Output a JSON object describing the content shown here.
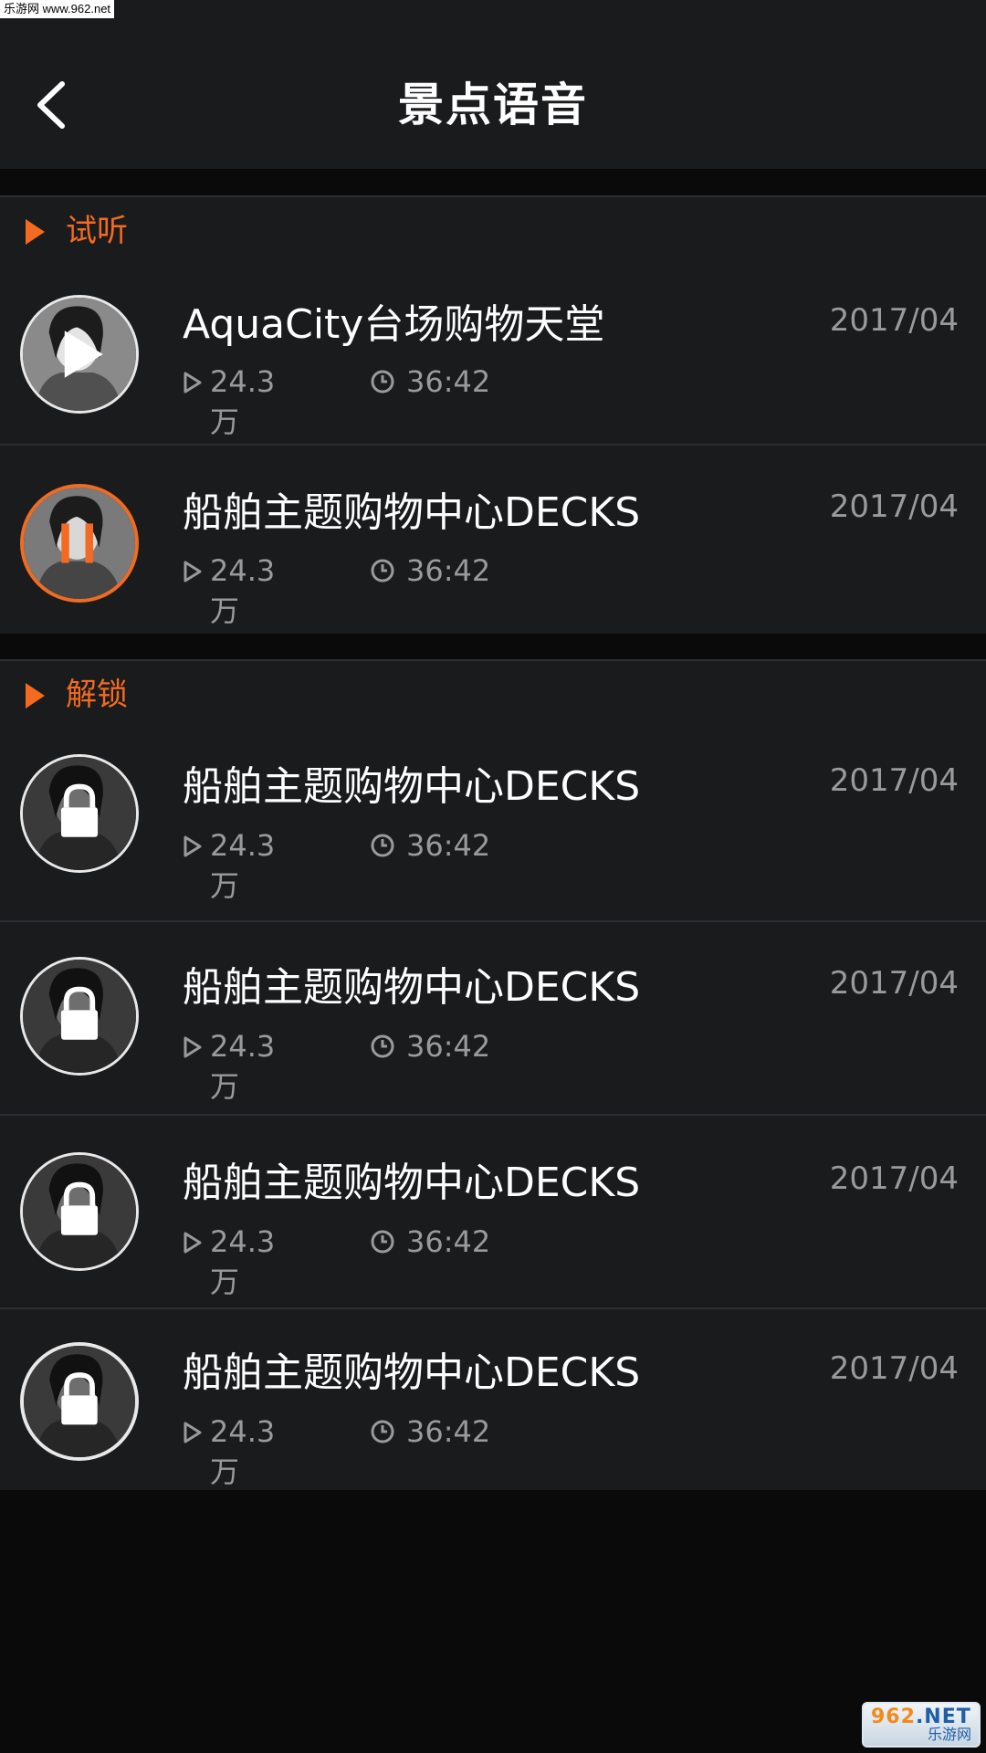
{
  "watermark_top": "乐游网 www.962.net",
  "header": {
    "title": "景点语音"
  },
  "sections": [
    {
      "label": "试听",
      "items": [
        {
          "title": "AquaCity台场购物天堂",
          "date": "2017/04",
          "plays": "24.3万",
          "duration": "36:42",
          "state": "play"
        },
        {
          "title": "船舶主题购物中心DECKS",
          "date": "2017/04",
          "plays": "24.3万",
          "duration": "36:42",
          "state": "pause"
        }
      ]
    },
    {
      "label": "解锁",
      "items": [
        {
          "title": "船舶主题购物中心DECKS",
          "date": "2017/04",
          "plays": "24.3万",
          "duration": "36:42",
          "state": "locked"
        },
        {
          "title": "船舶主题购物中心DECKS",
          "date": "2017/04",
          "plays": "24.3万",
          "duration": "36:42",
          "state": "locked"
        },
        {
          "title": "船舶主题购物中心DECKS",
          "date": "2017/04",
          "plays": "24.3万",
          "duration": "36:42",
          "state": "locked"
        },
        {
          "title": "船舶主题购物中心DECKS",
          "date": "2017/04",
          "plays": "24.3万",
          "duration": "36:42",
          "state": "locked"
        }
      ]
    }
  ],
  "watermark_logo": {
    "line1_a": "962",
    "line1_b": ".NET",
    "line2": "乐游网"
  },
  "colors": {
    "accent": "#f26b21",
    "background": "#1a1b1d",
    "text_secondary": "#9a9a9c"
  },
  "icons": {
    "back": "chevron-left-icon",
    "play": "play-icon",
    "pause": "pause-icon",
    "lock": "lock-icon",
    "clock": "clock-icon"
  }
}
